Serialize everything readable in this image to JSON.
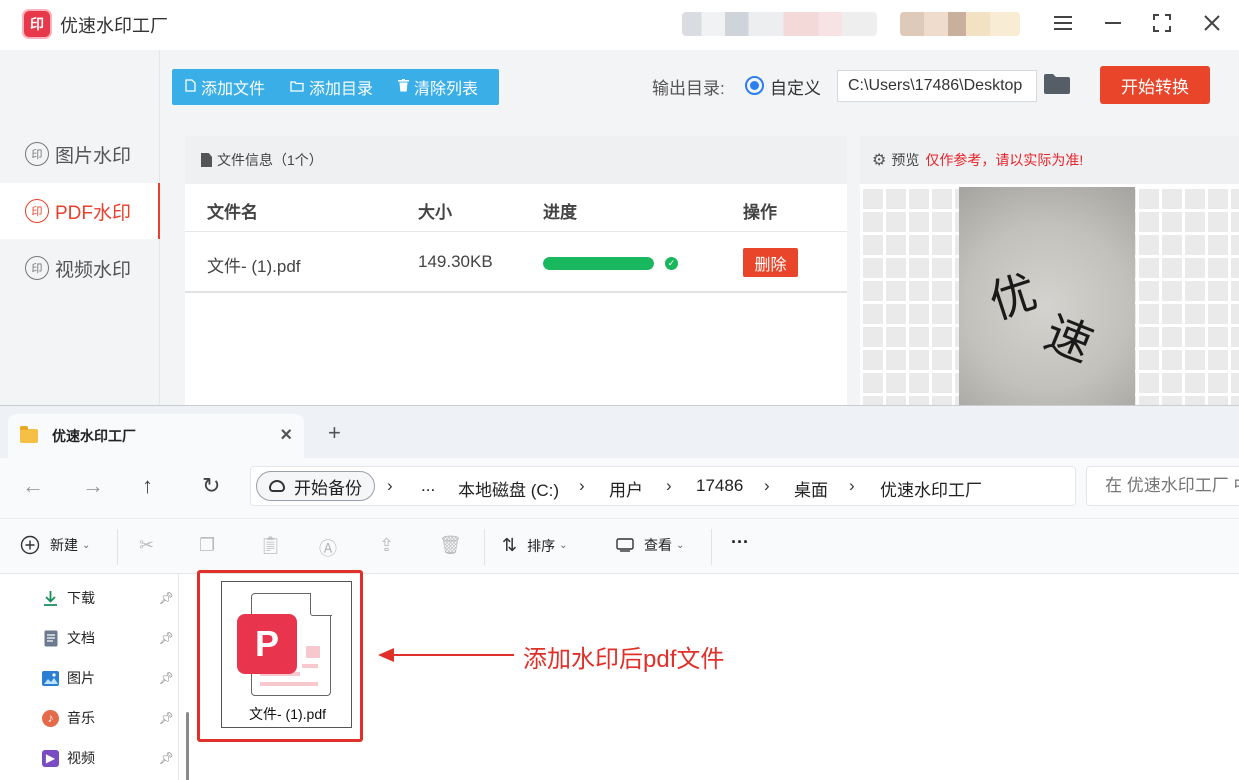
{
  "app": {
    "title": "优速水印工厂",
    "logo_text": "印",
    "window_controls": {
      "menu": "menu-icon",
      "minimize": "minimize-icon",
      "maximize": "maximize-icon",
      "close": "close-icon"
    }
  },
  "sidebar": {
    "items": [
      {
        "label": "图片水印",
        "icon": "印",
        "active": false
      },
      {
        "label": "PDF水印",
        "icon": "印",
        "active": true
      },
      {
        "label": "视频水印",
        "icon": "印",
        "active": false
      }
    ]
  },
  "toolbar": {
    "add_file": "添加文件",
    "add_dir": "添加目录",
    "clear_list": "清除列表"
  },
  "output": {
    "label": "输出目录:",
    "option": "自定义",
    "path": "C:\\Users\\17486\\Desktop",
    "start_button": "开始转换"
  },
  "file_panel": {
    "header": "文件信息（1个）",
    "columns": {
      "name": "文件名",
      "size": "大小",
      "progress": "进度",
      "action": "操作"
    },
    "rows": [
      {
        "name": "文件- (1).pdf",
        "size": "149.30KB",
        "progress": 1.0,
        "action": "删除"
      }
    ]
  },
  "preview": {
    "label": "预览",
    "warning": "仅作参考，请以实际为准!",
    "watermark_chars": [
      "优",
      "速"
    ]
  },
  "explorer": {
    "tab_title": "优速水印工厂",
    "tab_close": "×",
    "tab_add": "+",
    "nav": {
      "back": "←",
      "forward": "→",
      "up": "↑",
      "refresh": "↻"
    },
    "backup": "开始备份",
    "breadcrumb": [
      "...",
      "本地磁盘 (C:)",
      "用户",
      "17486",
      "桌面",
      "优速水印工厂"
    ],
    "search_placeholder": "在 优速水印工厂 中搜索",
    "commands": {
      "new": "新建",
      "sort": "排序",
      "view": "查看",
      "more": "···"
    },
    "quick_access": [
      {
        "label": "下载",
        "icon": "download-icon",
        "color": "#1a8f5a"
      },
      {
        "label": "文档",
        "icon": "document-icon",
        "color": "#6b7a8f"
      },
      {
        "label": "图片",
        "icon": "picture-icon",
        "color": "#2a7fd4"
      },
      {
        "label": "音乐",
        "icon": "music-icon",
        "color": "#e56a4b"
      },
      {
        "label": "视频",
        "icon": "video-icon",
        "color": "#7a4cc2"
      }
    ],
    "file": {
      "name": "文件- (1).pdf",
      "badge": "P"
    }
  },
  "annotation": {
    "text": "添加水印后pdf文件",
    "color": "#e0302a"
  }
}
